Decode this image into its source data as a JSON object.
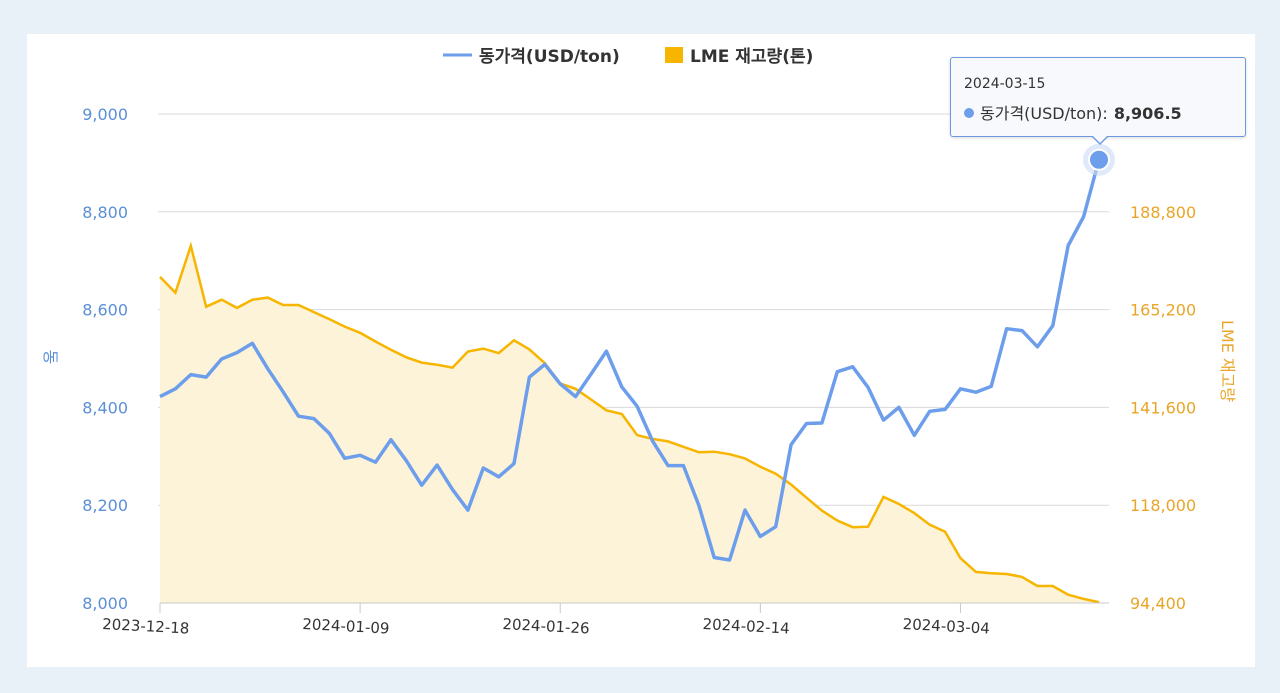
{
  "chart_data": {
    "type": "line",
    "legend": {
      "placement": "top-center",
      "items": [
        {
          "label": "동가격(USD/ton)",
          "symbol": "line"
        },
        {
          "label": "LME 재고량(톤)",
          "symbol": "box"
        }
      ]
    },
    "colors": {
      "price": "#6d9eeb",
      "inventory_line": "#f7b500",
      "inventory_fill": "#fdf3d8",
      "grid": "#d9d9d9",
      "left_axis": "#5b8fd6",
      "right_axis": "#e9a527"
    },
    "left_axis": {
      "title": "동",
      "ticks": [
        "8,000",
        "8,200",
        "8,400",
        "8,600",
        "8,800",
        "9,000"
      ],
      "ylim": [
        8000,
        9000
      ]
    },
    "right_axis": {
      "title": "LME 재고량",
      "ticks": [
        "94,400",
        "118,000",
        "141,600",
        "165,200",
        "188,800"
      ],
      "ylim": [
        94400,
        212400
      ]
    },
    "x_ticks": [
      {
        "index": 0,
        "label": "2023-12-18"
      },
      {
        "index": 13,
        "label": "2024-01-09"
      },
      {
        "index": 26,
        "label": "2024-01-26"
      },
      {
        "index": 39,
        "label": "2024-02-14"
      },
      {
        "index": 52,
        "label": "2024-03-04"
      }
    ],
    "grid": true,
    "series": [
      {
        "name": "동가격(USD/ton)",
        "axis": "left",
        "type": "line",
        "values": [
          8422,
          8438,
          8467,
          8462,
          8499,
          8512,
          8531,
          8479,
          8432,
          8382,
          8377,
          8347,
          8296,
          8302,
          8288,
          8334,
          8291,
          8241,
          8282,
          8232,
          8190,
          8276,
          8258,
          8285,
          8462,
          8488,
          8448,
          8422,
          8468,
          8515,
          8442,
          8402,
          8331,
          8281,
          8281,
          8200,
          8093,
          8088,
          8190,
          8136,
          8156,
          8324,
          8367,
          8368,
          8473,
          8483,
          8441,
          8374,
          8400,
          8343,
          8392,
          8396,
          8438,
          8431,
          8443,
          8561,
          8557,
          8524,
          8567,
          8731,
          8790,
          8906.5
        ]
      },
      {
        "name": "LME 재고량(톤)",
        "axis": "right",
        "type": "area",
        "values": [
          173100,
          169300,
          180600,
          165900,
          167600,
          165600,
          167600,
          168100,
          166300,
          166300,
          164600,
          162900,
          161100,
          159600,
          157500,
          155500,
          153700,
          152400,
          151900,
          151200,
          155100,
          155800,
          154700,
          157800,
          155600,
          152300,
          147400,
          146100,
          143500,
          140900,
          140000,
          134900,
          134000,
          133400,
          132100,
          130800,
          130900,
          130300,
          129300,
          127300,
          125600,
          123000,
          119800,
          116700,
          114300,
          112700,
          112800,
          120000,
          118300,
          116100,
          113300,
          111600,
          105200,
          101900,
          101600,
          101400,
          100700,
          98500,
          98500,
          96400,
          95400,
          94600
        ]
      }
    ],
    "tooltip": {
      "date": "2024-03-15",
      "series_label": "동가격(USD/ton):",
      "value": "8,906.5",
      "index": 61
    }
  }
}
